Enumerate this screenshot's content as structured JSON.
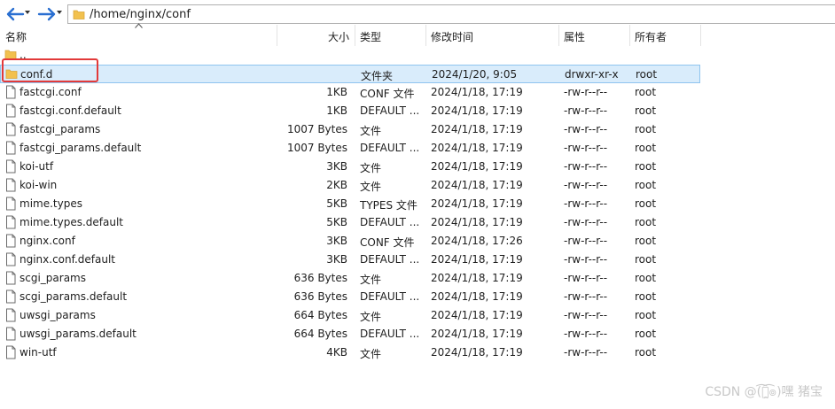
{
  "address": {
    "path": "/home/nginx/conf"
  },
  "columns": {
    "name": "名称",
    "size": "大小",
    "type": "类型",
    "modified": "修改时间",
    "perms": "属性",
    "owner": "所有者"
  },
  "parent_dir": {
    "name": ".."
  },
  "files": [
    {
      "name": "conf.d",
      "size": "",
      "type": "文件夹",
      "modified": "2024/1/20, 9:05",
      "perms": "drwxr-xr-x",
      "owner": "root",
      "icon": "folder-icon",
      "selected": true
    },
    {
      "name": "fastcgi.conf",
      "size": "1KB",
      "type": "CONF 文件",
      "modified": "2024/1/18, 17:19",
      "perms": "-rw-r--r--",
      "owner": "root",
      "icon": "file-icon"
    },
    {
      "name": "fastcgi.conf.default",
      "size": "1KB",
      "type": "DEFAULT ...",
      "modified": "2024/1/18, 17:19",
      "perms": "-rw-r--r--",
      "owner": "root",
      "icon": "file-icon"
    },
    {
      "name": "fastcgi_params",
      "size": "1007 Bytes",
      "type": "文件",
      "modified": "2024/1/18, 17:19",
      "perms": "-rw-r--r--",
      "owner": "root",
      "icon": "file-icon"
    },
    {
      "name": "fastcgi_params.default",
      "size": "1007 Bytes",
      "type": "DEFAULT ...",
      "modified": "2024/1/18, 17:19",
      "perms": "-rw-r--r--",
      "owner": "root",
      "icon": "file-icon"
    },
    {
      "name": "koi-utf",
      "size": "3KB",
      "type": "文件",
      "modified": "2024/1/18, 17:19",
      "perms": "-rw-r--r--",
      "owner": "root",
      "icon": "file-icon"
    },
    {
      "name": "koi-win",
      "size": "2KB",
      "type": "文件",
      "modified": "2024/1/18, 17:19",
      "perms": "-rw-r--r--",
      "owner": "root",
      "icon": "file-icon"
    },
    {
      "name": "mime.types",
      "size": "5KB",
      "type": "TYPES 文件",
      "modified": "2024/1/18, 17:19",
      "perms": "-rw-r--r--",
      "owner": "root",
      "icon": "file-icon"
    },
    {
      "name": "mime.types.default",
      "size": "5KB",
      "type": "DEFAULT ...",
      "modified": "2024/1/18, 17:19",
      "perms": "-rw-r--r--",
      "owner": "root",
      "icon": "file-icon"
    },
    {
      "name": "nginx.conf",
      "size": "3KB",
      "type": "CONF 文件",
      "modified": "2024/1/18, 17:26",
      "perms": "-rw-r--r--",
      "owner": "root",
      "icon": "file-icon"
    },
    {
      "name": "nginx.conf.default",
      "size": "3KB",
      "type": "DEFAULT ...",
      "modified": "2024/1/18, 17:19",
      "perms": "-rw-r--r--",
      "owner": "root",
      "icon": "file-icon"
    },
    {
      "name": "scgi_params",
      "size": "636 Bytes",
      "type": "文件",
      "modified": "2024/1/18, 17:19",
      "perms": "-rw-r--r--",
      "owner": "root",
      "icon": "file-icon"
    },
    {
      "name": "scgi_params.default",
      "size": "636 Bytes",
      "type": "DEFAULT ...",
      "modified": "2024/1/18, 17:19",
      "perms": "-rw-r--r--",
      "owner": "root",
      "icon": "file-icon"
    },
    {
      "name": "uwsgi_params",
      "size": "664 Bytes",
      "type": "文件",
      "modified": "2024/1/18, 17:19",
      "perms": "-rw-r--r--",
      "owner": "root",
      "icon": "file-icon"
    },
    {
      "name": "uwsgi_params.default",
      "size": "664 Bytes",
      "type": "DEFAULT ...",
      "modified": "2024/1/18, 17:19",
      "perms": "-rw-r--r--",
      "owner": "root",
      "icon": "file-icon"
    },
    {
      "name": "win-utf",
      "size": "4KB",
      "type": "文件",
      "modified": "2024/1/18, 17:19",
      "perms": "-rw-r--r--",
      "owner": "root",
      "icon": "file-icon"
    }
  ],
  "watermark": "CSDN @(͡๏̯͡๏)嘿 猪宝",
  "colors": {
    "selection": "#d9ecfb",
    "highlight": "#e23a3a",
    "folder": "#f2c14e",
    "nav_arrow": "#2a6fd1"
  }
}
